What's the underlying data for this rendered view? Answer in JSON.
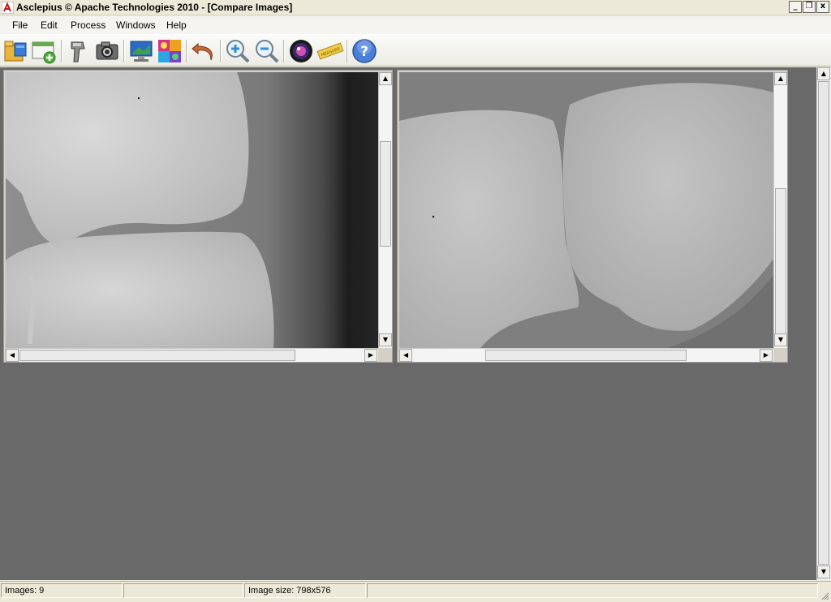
{
  "window": {
    "title": "Asclepius © Apache Technologies 2010 - [Compare Images]",
    "controls": {
      "minimize": "_",
      "restore": "❐",
      "close": "x"
    }
  },
  "menu": [
    {
      "label": "File"
    },
    {
      "label": "Edit"
    },
    {
      "label": "Process"
    },
    {
      "label": "Windows"
    },
    {
      "label": "Help"
    }
  ],
  "toolbar": {
    "icons": [
      "open-folder-icon",
      "add-image-icon",
      "scanner-icon",
      "camera-icon",
      "monitor-icon",
      "color-palette-icon",
      "undo-icon",
      "zoom-in-icon",
      "zoom-out-icon",
      "lens-icon",
      "measure-icon",
      "help-icon"
    ],
    "measure_text": "MEASURE",
    "help_text": "?"
  },
  "colors": {
    "workspace": "#696969",
    "chrome": "#ece9d8",
    "help_blue": "#4a7fd9"
  },
  "images": [
    {
      "name": "knee-xray-left"
    },
    {
      "name": "knee-xray-right"
    }
  ],
  "status": {
    "images_count": "Images: 9",
    "pane2": "",
    "image_size": "Image size: 798x576",
    "pane4": ""
  }
}
